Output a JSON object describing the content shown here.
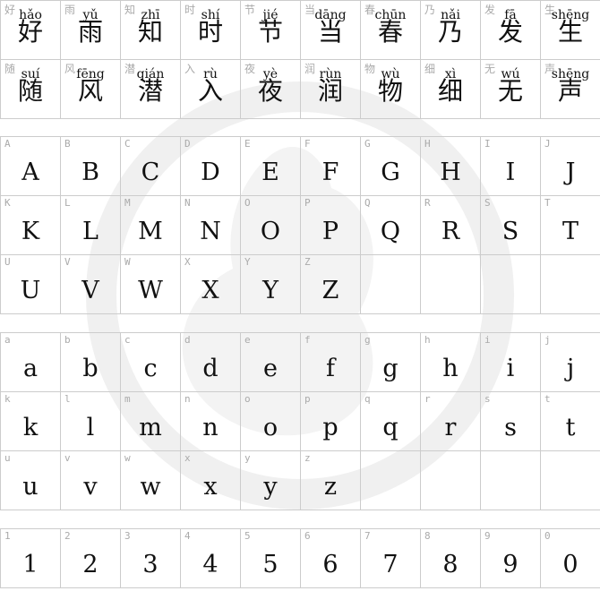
{
  "hanzi": [
    {
      "c": "好",
      "p": "hǎo"
    },
    {
      "c": "雨",
      "p": "yǔ"
    },
    {
      "c": "知",
      "p": "zhī"
    },
    {
      "c": "时",
      "p": "shí"
    },
    {
      "c": "节",
      "p": "jié"
    },
    {
      "c": "当",
      "p": "dāng"
    },
    {
      "c": "春",
      "p": "chūn"
    },
    {
      "c": "乃",
      "p": "nǎi"
    },
    {
      "c": "发",
      "p": "fā"
    },
    {
      "c": "生",
      "p": "shēng"
    },
    {
      "c": "随",
      "p": "suí"
    },
    {
      "c": "风",
      "p": "fēng"
    },
    {
      "c": "潜",
      "p": "qián"
    },
    {
      "c": "入",
      "p": "rù"
    },
    {
      "c": "夜",
      "p": "yè"
    },
    {
      "c": "润",
      "p": "rùn"
    },
    {
      "c": "物",
      "p": "wù"
    },
    {
      "c": "细",
      "p": "xì"
    },
    {
      "c": "无",
      "p": "wú"
    },
    {
      "c": "声",
      "p": "shēng"
    }
  ],
  "uppercase": [
    "A",
    "B",
    "C",
    "D",
    "E",
    "F",
    "G",
    "H",
    "I",
    "J",
    "K",
    "L",
    "M",
    "N",
    "O",
    "P",
    "Q",
    "R",
    "S",
    "T",
    "U",
    "V",
    "W",
    "X",
    "Y",
    "Z"
  ],
  "lowercase": [
    "a",
    "b",
    "c",
    "d",
    "e",
    "f",
    "g",
    "h",
    "i",
    "j",
    "k",
    "l",
    "m",
    "n",
    "o",
    "p",
    "q",
    "r",
    "s",
    "t",
    "u",
    "v",
    "w",
    "x",
    "y",
    "z"
  ],
  "digits": [
    "1",
    "2",
    "3",
    "4",
    "5",
    "6",
    "7",
    "8",
    "9",
    "0"
  ],
  "watermark_color": "#f0f0f0"
}
